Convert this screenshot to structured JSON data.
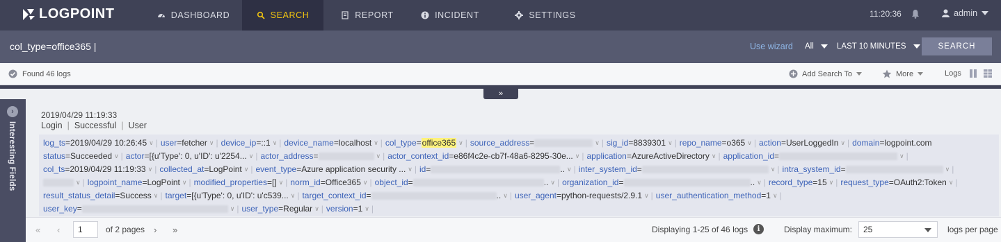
{
  "nav": {
    "brand": "LOGPOINT",
    "tabs": [
      {
        "label": "DASHBOARD",
        "icon": "dashboard-icon"
      },
      {
        "label": "SEARCH",
        "icon": "search-icon"
      },
      {
        "label": "REPORT",
        "icon": "report-icon"
      },
      {
        "label": "INCIDENT",
        "icon": "info-icon"
      },
      {
        "label": "SETTINGS",
        "icon": "gear-icon"
      }
    ],
    "active_tab": "SEARCH",
    "time": "11:20:36",
    "user": "admin"
  },
  "search": {
    "query": "col_type=office365 |",
    "wizard_label": "Use wizard",
    "repo_select": "All",
    "time_range": "LAST 10 MINUTES",
    "button_label": "SEARCH"
  },
  "toolbar": {
    "found": "Found 46 logs",
    "add_search_to": "Add Search To",
    "more": "More",
    "logs": "Logs"
  },
  "sidebar": {
    "label": "Interesting Fields"
  },
  "log": {
    "timestamp": "2019/04/29 11:19:33",
    "summary": [
      "Login",
      "Successful",
      "User"
    ],
    "rows": [
      [
        {
          "k": "log_ts",
          "v": "2019/04/29 10:26:45"
        },
        {
          "k": "user",
          "v": "fetcher"
        },
        {
          "k": "device_ip",
          "v": "::1"
        },
        {
          "k": "device_name",
          "v": "localhost"
        },
        {
          "k": "col_type",
          "v": "office365",
          "highlight": true
        },
        {
          "k": "source_address",
          "v": "",
          "blur": 84
        },
        {
          "k": "sig_id",
          "v": "8839301"
        },
        {
          "k": "repo_name",
          "v": "o365"
        },
        {
          "k": "action",
          "v": "UserLoggedIn"
        },
        {
          "k": "domain",
          "v": "logpoint.com",
          "nocaret": true
        }
      ],
      [
        {
          "k": "status",
          "v": "Succeeded"
        },
        {
          "k": "actor",
          "v": "[{u'Type': 0, u'ID': u'2254..."
        },
        {
          "k": "actor_address",
          "v": "",
          "blur": 80
        },
        {
          "k": "actor_context_id",
          "v": "e86f4c2e-cb7f-48a6-8295-30e..."
        },
        {
          "k": "application",
          "v": "AzureActiveDirectory"
        },
        {
          "k": "application_id",
          "v": "",
          "blur": 170
        }
      ],
      [
        {
          "k": "col_ts",
          "v": "2019/04/29 11:19:33"
        },
        {
          "k": "collected_at",
          "v": "LogPoint"
        },
        {
          "k": "event_type",
          "v": "Azure application security ..."
        },
        {
          "k": "id",
          "v": "",
          "blur": 186,
          "suffix": ".."
        },
        {
          "k": "inter_system_id",
          "v": "",
          "blur": 182
        },
        {
          "k": "intra_system_id",
          "v": "",
          "blur": 140
        }
      ],
      [
        {
          "k": "",
          "v": "",
          "blur": 44
        },
        {
          "k": "logpoint_name",
          "v": "LogPoint"
        },
        {
          "k": "modified_properties",
          "v": "[]"
        },
        {
          "k": "norm_id",
          "v": "Office365"
        },
        {
          "k": "object_id",
          "v": "",
          "blur": 188,
          "suffix": ".."
        },
        {
          "k": "organization_id",
          "v": "",
          "blur": 182,
          "suffix": ".."
        },
        {
          "k": "record_type",
          "v": "15"
        },
        {
          "k": "request_type",
          "v": "OAuth2:Token"
        }
      ],
      [
        {
          "k": "result_status_detail",
          "v": "Success"
        },
        {
          "k": "target",
          "v": "[{u'Type': 0, u'ID': u'c539..."
        },
        {
          "k": "target_context_id",
          "v": "",
          "blur": 180,
          "suffix": ".."
        },
        {
          "k": "user_agent",
          "v": "python-requests/2.9.1"
        },
        {
          "k": "user_authentication_method",
          "v": "1"
        }
      ],
      [
        {
          "k": "user_key",
          "v": "",
          "blur": 210
        },
        {
          "k": "user_type",
          "v": "Regular"
        },
        {
          "k": "version",
          "v": "1"
        }
      ]
    ]
  },
  "pager": {
    "page": "1",
    "of_pages": "of 2 pages",
    "displaying": "Displaying 1-25 of 46 logs",
    "display_max_label": "Display maximum:",
    "display_max": "25",
    "per_page": "logs per page"
  },
  "colors": {
    "nav_bg": "#3f4256",
    "active_tab_text": "#f1c40f",
    "field_key": "#3d63b8",
    "highlight": "#fff27a"
  }
}
